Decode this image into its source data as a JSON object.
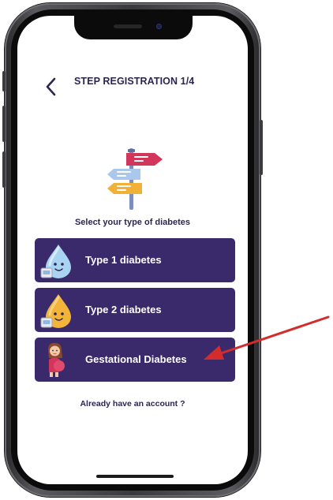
{
  "header": {
    "title": "STEP REGISTRATION 1/4",
    "back_icon": "chevron-left-icon"
  },
  "illustration": {
    "icon": "signpost-icon",
    "colors": {
      "red": "#d2365a",
      "blue": "#a9c8ec",
      "yellow": "#f0b136",
      "pole": "#7b8fbf"
    }
  },
  "prompt": "Select your type of diabetes",
  "options": [
    {
      "label": "Type 1 diabetes",
      "icon": "blue-drop-mascot-icon"
    },
    {
      "label": "Type 2 diabetes",
      "icon": "orange-drop-mascot-icon"
    },
    {
      "label": "Gestational Diabetes",
      "icon": "pregnant-woman-icon"
    }
  ],
  "login_link": "Already have an account ?",
  "annotation": {
    "icon": "red-arrow-icon",
    "color": "#d42b2b"
  },
  "colors": {
    "primary": "#3b2a6b",
    "text": "#2c2550",
    "background": "#ffffff"
  }
}
